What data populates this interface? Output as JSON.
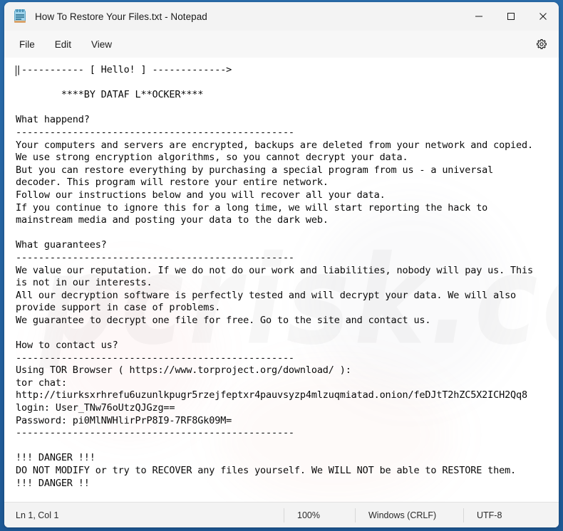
{
  "window": {
    "title": "How To Restore Your Files.txt - Notepad",
    "icon": "notepad-icon",
    "controls": {
      "minimize": "minimize-icon",
      "maximize": "maximize-icon",
      "close": "close-icon"
    }
  },
  "menubar": {
    "items": [
      {
        "label": "File"
      },
      {
        "label": "Edit"
      },
      {
        "label": "View"
      }
    ],
    "settings_icon": "gear-icon"
  },
  "editor": {
    "content": "|----------- [ Hello! ] ------------->\n\n        ****BY DATAF L**OCKER****\n\nWhat happend?\n-------------------------------------------------\nYour computers and servers are encrypted, backups are deleted from your network and copied.\nWe use strong encryption algorithms, so you cannot decrypt your data.\nBut you can restore everything by purchasing a special program from us - a universal\ndecoder. This program will restore your entire network.\nFollow our instructions below and you will recover all your data.\nIf you continue to ignore this for a long time, we will start reporting the hack to\nmainstream media and posting your data to the dark web.\n\nWhat guarantees?\n-------------------------------------------------\nWe value our reputation. If we do not do our work and liabilities, nobody will pay us. This\nis not in our interests.\nAll our decryption software is perfectly tested and will decrypt your data. We will also\nprovide support in case of problems.\nWe guarantee to decrypt one file for free. Go to the site and contact us.\n\nHow to contact us?\n-------------------------------------------------\nUsing TOR Browser ( https://www.torproject.org/download/ ):\ntor chat:\nhttp://tiurksxrhrefu6uzunlkpugr5rzejfeptxr4pauvsyzp4mlzuqmiatad.onion/feDJtT2hZC5X2ICH2Qq8\nlogin: User_TNw76oUtzQJGzg==\nPassword: pi0MlNWHlirPrP8I9-7RF8Gk09M=\n-------------------------------------------------\n\n!!! DANGER !!!\nDO NOT MODIFY or try to RECOVER any files yourself. We WILL NOT be able to RESTORE them.\n!!! DANGER !!"
  },
  "watermark": {
    "text": "pcrisk.com"
  },
  "statusbar": {
    "position": "Ln 1, Col 1",
    "zoom": "100%",
    "line_endings": "Windows (CRLF)",
    "encoding": "UTF-8"
  },
  "colors": {
    "desktop": "#1f5c99",
    "window_chrome": "#f3f3f3",
    "editor_background": "#ffffff",
    "text": "#0a0a0a",
    "close_hover": "#c42b1c"
  }
}
